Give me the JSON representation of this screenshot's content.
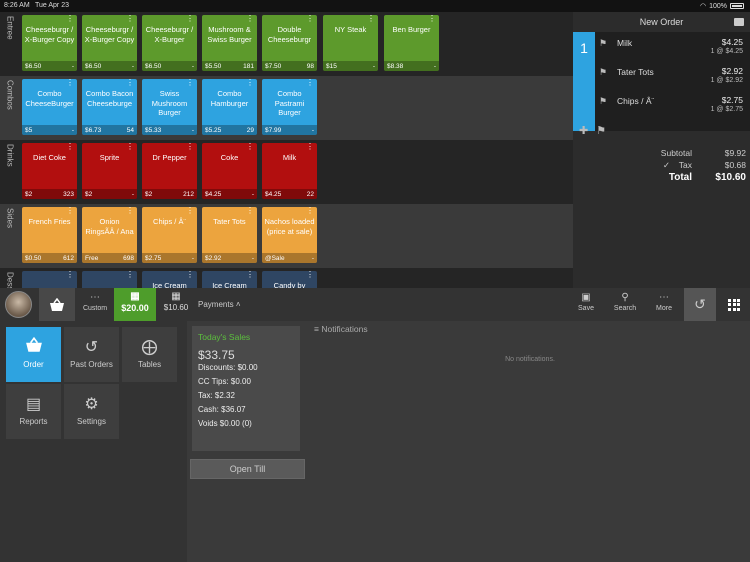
{
  "status_bar": {
    "time": "8:26 AM",
    "date": "Tue Apr 23",
    "battery": "100%"
  },
  "menu": {
    "rows": [
      {
        "label": "Entree",
        "tiles": [
          {
            "name": "Cheeseburgr / X-Burger Copy",
            "price": "$6.50",
            "stock": "-",
            "color": "#5d9a2c"
          },
          {
            "name": "Cheeseburgr / X-Burger Copy",
            "price": "$6.50",
            "stock": "-",
            "color": "#5d9a2c"
          },
          {
            "name": "Cheeseburgr / X-Burger",
            "price": "$6.50",
            "stock": "-",
            "color": "#5d9a2c"
          },
          {
            "name": "Mushroom & Swiss Burger",
            "price": "$5.50",
            "stock": "181",
            "color": "#5d9a2c"
          },
          {
            "name": "Double Cheeseburgr",
            "price": "$7.50",
            "stock": "98",
            "color": "#5d9a2c"
          },
          {
            "name": "NY Steak",
            "price": "$15",
            "stock": "-",
            "color": "#5d9a2c"
          },
          {
            "name": "Ben Burger",
            "price": "$8.38",
            "stock": "-",
            "color": "#5d9a2c"
          }
        ]
      },
      {
        "label": "Combos",
        "tiles": [
          {
            "name": "Combo CheeseBurger",
            "price": "$5",
            "stock": "-",
            "color": "#2ea3e0"
          },
          {
            "name": "Combo Bacon Cheeseburge",
            "price": "$6.73",
            "stock": "54",
            "color": "#2ea3e0"
          },
          {
            "name": "Swiss Mushroom Burger",
            "price": "$5.33",
            "stock": "-",
            "color": "#2ea3e0"
          },
          {
            "name": "Combo Hamburger",
            "price": "$5.25",
            "stock": "29",
            "color": "#2ea3e0"
          },
          {
            "name": "Combo Pastrami Burger",
            "price": "$7.99",
            "stock": "-",
            "color": "#2ea3e0"
          }
        ]
      },
      {
        "label": "Drinks",
        "tiles": [
          {
            "name": "Diet Coke",
            "price": "$2",
            "stock": "323",
            "color": "#b20f0f"
          },
          {
            "name": "Sprite",
            "price": "$2",
            "stock": "-",
            "color": "#b20f0f"
          },
          {
            "name": "Dr Pepper",
            "price": "$2",
            "stock": "212",
            "color": "#b20f0f"
          },
          {
            "name": "Coke",
            "price": "$4.25",
            "stock": "-",
            "color": "#b20f0f"
          },
          {
            "name": "Milk",
            "price": "$4.25",
            "stock": "22",
            "color": "#b20f0f"
          }
        ]
      },
      {
        "label": "Sides",
        "tiles": [
          {
            "name": "French Fries",
            "price": "$0.50",
            "stock": "612",
            "color": "#eca43e"
          },
          {
            "name": "Onion RingsÃÂ / Ana",
            "price": "Free",
            "stock": "698",
            "color": "#eca43e"
          },
          {
            "name": "Chips / Â¨",
            "price": "$2.75",
            "stock": "-",
            "color": "#eca43e"
          },
          {
            "name": "Tater Tots",
            "price": "$2.92",
            "stock": "-",
            "color": "#eca43e"
          },
          {
            "name": "Nachos loaded (price at sale)",
            "price": "@Sale",
            "stock": "-",
            "color": "#eca43e"
          }
        ]
      },
      {
        "label": "Dess",
        "tiles": [
          {
            "name": "",
            "price": "",
            "stock": "",
            "color": "#2f4663"
          },
          {
            "name": "",
            "price": "",
            "stock": "",
            "color": "#2f4663"
          },
          {
            "name": "Ice Cream",
            "price": "",
            "stock": "",
            "color": "#2f4663"
          },
          {
            "name": "Ice Cream",
            "price": "",
            "stock": "",
            "color": "#2f4663"
          },
          {
            "name": "Candy by",
            "price": "",
            "stock": "",
            "color": "#2f4663"
          }
        ]
      }
    ]
  },
  "order": {
    "title": "New Order",
    "seat": "1",
    "items": [
      {
        "name": "Milk",
        "price": "$4.25",
        "qty": "1 @ $4.25"
      },
      {
        "name": "Tater Tots",
        "price": "$2.92",
        "qty": "1 @ $2.92"
      },
      {
        "name": "Chips / Â¨",
        "price": "$2.75",
        "qty": "1 @ $2.75"
      }
    ],
    "subtotal_label": "Subtotal",
    "subtotal": "$9.92",
    "tax_label": "Tax",
    "tax": "$0.68",
    "total_label": "Total",
    "total": "$10.60"
  },
  "toolbar": {
    "custom_label": "Custom",
    "cash1": "$20.00",
    "cash2": "$10.60",
    "payments_label": "Payments",
    "save_label": "Save",
    "search_label": "Search",
    "more_label": "More"
  },
  "nav": {
    "order_label": "Order",
    "past_orders_label": "Past Orders",
    "tables_label": "Tables",
    "reports_label": "Reports",
    "settings_label": "Settings"
  },
  "sales": {
    "title": "Today's Sales",
    "amount": "$33.75",
    "discounts": "Discounts: $0.00",
    "cc_tips": "CC Tips: $0.00",
    "tax": "Tax: $2.32",
    "cash": "Cash: $36.07",
    "voids": "Voids $0.00 (0)"
  },
  "open_till_label": "Open Till",
  "notifications": {
    "title": "Notifications",
    "empty": "No notifications."
  }
}
